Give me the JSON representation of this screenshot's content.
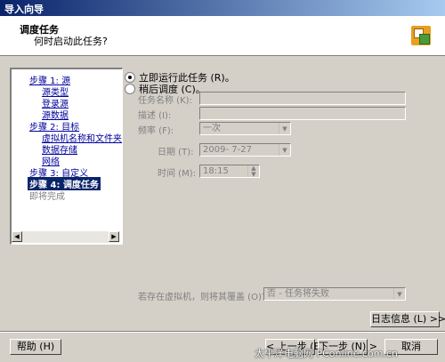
{
  "window": {
    "title": "导入向导"
  },
  "header": {
    "title": "调度任务",
    "subtitle": "何时启动此任务?"
  },
  "nav": {
    "items": [
      {
        "label": "步骤 1: 源",
        "kind": "link"
      },
      {
        "label": "源类型",
        "kind": "link"
      },
      {
        "label": "登录源",
        "kind": "link"
      },
      {
        "label": "源数据",
        "kind": "link"
      },
      {
        "label": "步骤 2: 目标",
        "kind": "link"
      },
      {
        "label": "虚拟机名称和文件夹",
        "kind": "link"
      },
      {
        "label": "数据存储",
        "kind": "link"
      },
      {
        "label": "网络",
        "kind": "link"
      },
      {
        "label": "步骤 3: 自定义",
        "kind": "link"
      },
      {
        "label": "步骤 4: 调度任务",
        "kind": "selected"
      },
      {
        "label": "即将完成",
        "kind": "disabled"
      }
    ]
  },
  "options": {
    "run_now": "立即运行此任务 (R)。",
    "schedule_later": "稍后调度 (C)。"
  },
  "form": {
    "task_name_label": "任务名称 (K):",
    "task_name_value": "",
    "description_label": "描述 (I):",
    "description_value": "",
    "frequency_label": "频率 (F):",
    "frequency_value": "一次",
    "date_label": "日期 (T):",
    "date_value": "2009- 7-27",
    "time_label": "时间 (M):",
    "time_value": "18:15",
    "overwrite_label": "若存在虚拟机，则将其覆盖 (O)?",
    "overwrite_value": "否 - 任务将失败"
  },
  "buttons": {
    "log": "日志信息 (L) >>",
    "help": "帮助 (H)",
    "back": "< 上一步 (B)",
    "next": "下一步 (N) >",
    "cancel": "取消"
  },
  "watermark": "太平洋电脑网 PConline.com.cn",
  "colors": {
    "title_bar": "#0a246a",
    "link": "#00009c",
    "face": "#d4d0c8"
  }
}
